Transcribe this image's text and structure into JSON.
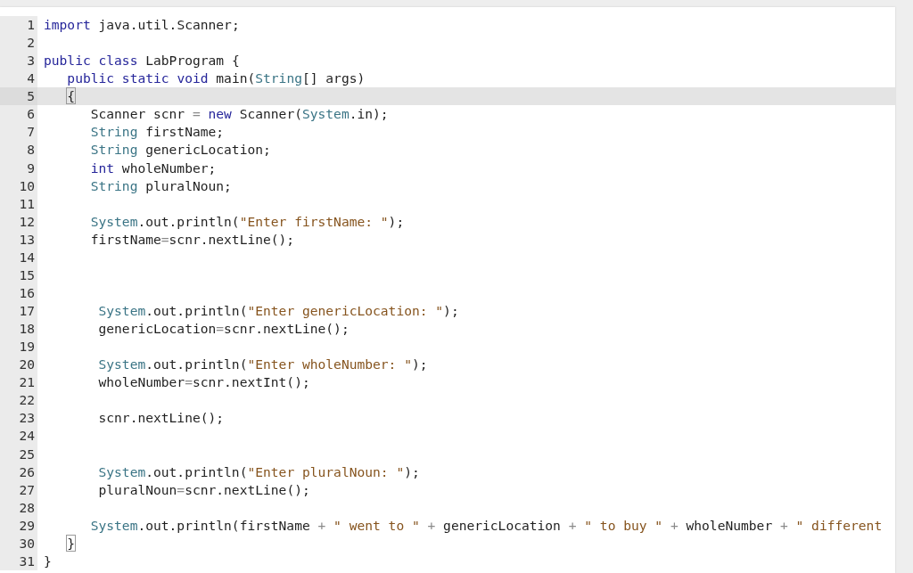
{
  "editor": {
    "lines": [
      {
        "number": "1",
        "active": false,
        "tokens": [
          {
            "kind": "kw",
            "text": "import "
          },
          {
            "kind": "plain",
            "text": "java.util.Scanner;"
          }
        ]
      },
      {
        "number": "2",
        "active": false
      },
      {
        "number": "3",
        "active": false,
        "tokens": [
          {
            "kind": "kw",
            "text": "public "
          },
          {
            "kind": "kw",
            "text": "class "
          },
          {
            "kind": "plain",
            "text": "LabProgram {"
          }
        ],
        "children": [
          {
            "number": "4",
            "active": false,
            "tokens": [
              {
                "kind": "kw",
                "text": "public "
              },
              {
                "kind": "kw",
                "text": "static "
              },
              {
                "kind": "kw",
                "text": "void "
              },
              {
                "kind": "plain",
                "text": "main("
              },
              {
                "kind": "type",
                "text": "String"
              },
              {
                "kind": "plain",
                "text": "[] args)"
              }
            ]
          },
          {
            "number": "5",
            "active": true,
            "tokens": [
              {
                "kind": "bracket",
                "text": "{"
              }
            ],
            "children": [
              {
                "number": "6",
                "active": false,
                "tokens": [
                  {
                    "kind": "plain",
                    "text": "Scanner scnr "
                  },
                  {
                    "kind": "op",
                    "text": "= "
                  },
                  {
                    "kind": "kw",
                    "text": "new "
                  },
                  {
                    "kind": "plain",
                    "text": "Scanner("
                  },
                  {
                    "kind": "type",
                    "text": "System"
                  },
                  {
                    "kind": "plain",
                    "text": ".in);"
                  }
                ]
              },
              {
                "number": "7",
                "active": false,
                "tokens": [
                  {
                    "kind": "type",
                    "text": "String "
                  },
                  {
                    "kind": "plain",
                    "text": "firstName;"
                  }
                ]
              },
              {
                "number": "8",
                "active": false,
                "tokens": [
                  {
                    "kind": "type",
                    "text": "String "
                  },
                  {
                    "kind": "plain",
                    "text": "genericLocation;"
                  }
                ]
              },
              {
                "number": "9",
                "active": false,
                "tokens": [
                  {
                    "kind": "kw",
                    "text": "int "
                  },
                  {
                    "kind": "plain",
                    "text": "wholeNumber;"
                  }
                ]
              },
              {
                "number": "10",
                "active": false,
                "tokens": [
                  {
                    "kind": "type",
                    "text": "String "
                  },
                  {
                    "kind": "plain",
                    "text": "pluralNoun;"
                  }
                ]
              },
              {
                "number": "11",
                "active": false
              },
              {
                "number": "12",
                "active": false,
                "tokens": [
                  {
                    "kind": "type",
                    "text": "System"
                  },
                  {
                    "kind": "plain",
                    "text": ".out.println("
                  },
                  {
                    "kind": "str",
                    "text": "\"Enter firstName: \""
                  },
                  {
                    "kind": "plain",
                    "text": ");"
                  }
                ]
              },
              {
                "number": "13",
                "active": false,
                "tokens": [
                  {
                    "kind": "plain",
                    "text": "firstName"
                  },
                  {
                    "kind": "op",
                    "text": "="
                  },
                  {
                    "kind": "plain",
                    "text": "scnr.nextLine();"
                  }
                ]
              },
              {
                "number": "14",
                "active": false
              },
              {
                "number": "15",
                "active": false
              },
              {
                "number": "16",
                "active": false
              },
              {
                "number": "17",
                "active": false,
                "tokens": [
                  {
                    "kind": "type",
                    "text": " System"
                  },
                  {
                    "kind": "plain",
                    "text": ".out.println("
                  },
                  {
                    "kind": "str",
                    "text": "\"Enter genericLocation: \""
                  },
                  {
                    "kind": "plain",
                    "text": ");"
                  }
                ]
              },
              {
                "number": "18",
                "active": false,
                "tokens": [
                  {
                    "kind": "plain",
                    "text": " genericLocation"
                  },
                  {
                    "kind": "op",
                    "text": "="
                  },
                  {
                    "kind": "plain",
                    "text": "scnr.nextLine();"
                  }
                ]
              },
              {
                "number": "19",
                "active": false
              },
              {
                "number": "20",
                "active": false,
                "tokens": [
                  {
                    "kind": "type",
                    "text": " System"
                  },
                  {
                    "kind": "plain",
                    "text": ".out.println("
                  },
                  {
                    "kind": "str",
                    "text": "\"Enter wholeNumber: \""
                  },
                  {
                    "kind": "plain",
                    "text": ");"
                  }
                ]
              },
              {
                "number": "21",
                "active": false,
                "tokens": [
                  {
                    "kind": "plain",
                    "text": " wholeNumber"
                  },
                  {
                    "kind": "op",
                    "text": "="
                  },
                  {
                    "kind": "plain",
                    "text": "scnr.nextInt();"
                  }
                ]
              },
              {
                "number": "22",
                "active": false
              },
              {
                "number": "23",
                "active": false,
                "tokens": [
                  {
                    "kind": "plain",
                    "text": " scnr.nextLine();"
                  }
                ]
              },
              {
                "number": "24",
                "active": false
              },
              {
                "number": "25",
                "active": false
              },
              {
                "number": "26",
                "active": false,
                "tokens": [
                  {
                    "kind": "type",
                    "text": " System"
                  },
                  {
                    "kind": "plain",
                    "text": ".out.println("
                  },
                  {
                    "kind": "str",
                    "text": "\"Enter pluralNoun: \""
                  },
                  {
                    "kind": "plain",
                    "text": ");"
                  }
                ]
              },
              {
                "number": "27",
                "active": false,
                "tokens": [
                  {
                    "kind": "plain",
                    "text": " pluralNoun"
                  },
                  {
                    "kind": "op",
                    "text": "="
                  },
                  {
                    "kind": "plain",
                    "text": "scnr.nextLine();"
                  }
                ]
              },
              {
                "number": "28",
                "active": false
              },
              {
                "number": "29",
                "active": false,
                "tokens": [
                  {
                    "kind": "type",
                    "text": "System"
                  },
                  {
                    "kind": "plain",
                    "text": ".out.println(firstName "
                  },
                  {
                    "kind": "op",
                    "text": "+ "
                  },
                  {
                    "kind": "str",
                    "text": "\" went to \" "
                  },
                  {
                    "kind": "op",
                    "text": "+ "
                  },
                  {
                    "kind": "plain",
                    "text": "genericLocation "
                  },
                  {
                    "kind": "op",
                    "text": "+ "
                  },
                  {
                    "kind": "str",
                    "text": "\" to buy \" "
                  },
                  {
                    "kind": "op",
                    "text": "+ "
                  },
                  {
                    "kind": "plain",
                    "text": "wholeNumber "
                  },
                  {
                    "kind": "op",
                    "text": "+ "
                  },
                  {
                    "kind": "str",
                    "text": "\" different"
                  }
                ]
              }
            ]
          },
          {
            "number": "30",
            "active": false,
            "tokens": [
              {
                "kind": "bracket",
                "text": "}"
              }
            ]
          }
        ]
      },
      {
        "number": "31",
        "active": false,
        "tokens": [
          {
            "kind": "plain",
            "text": "}"
          }
        ]
      }
    ]
  }
}
